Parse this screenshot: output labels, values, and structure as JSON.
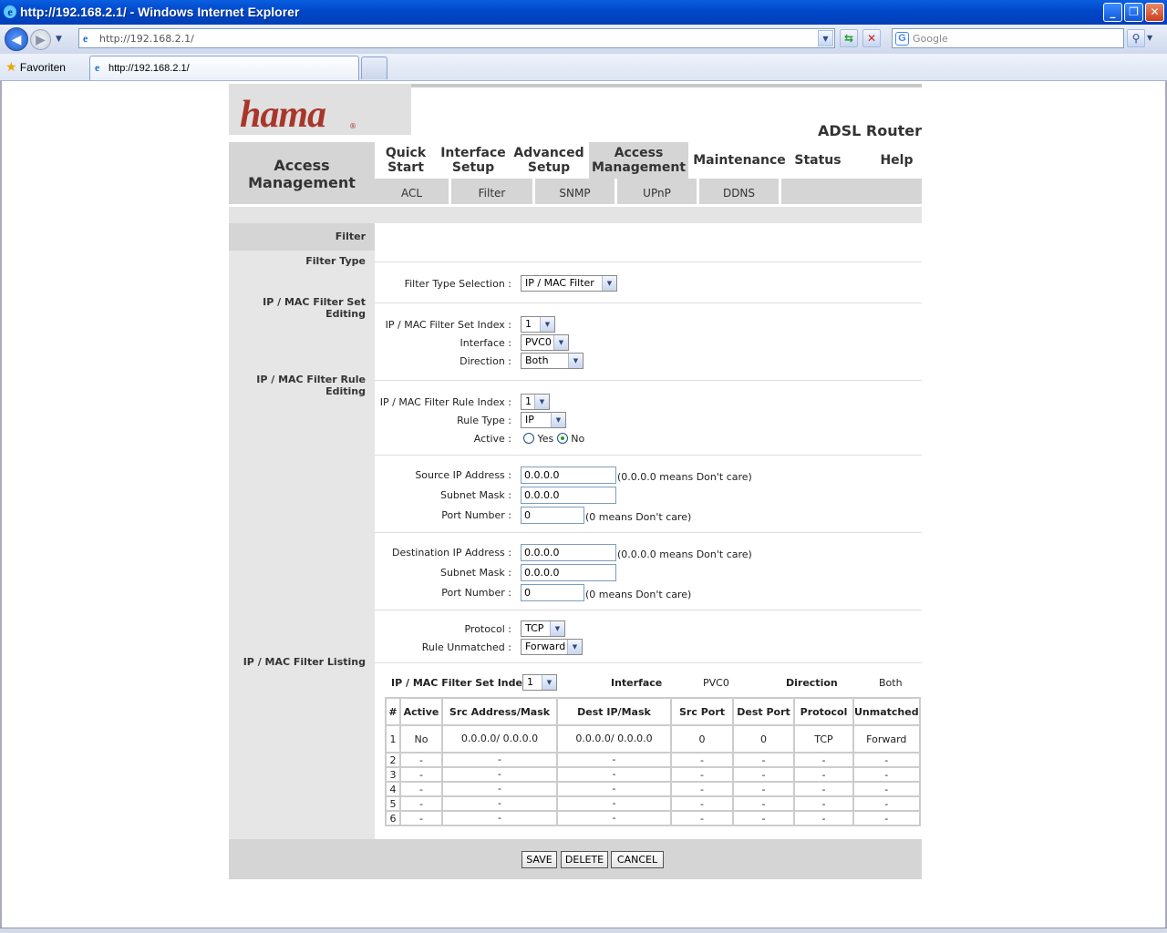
{
  "window": {
    "title": "http://192.168.2.1/ - Windows Internet Explorer"
  },
  "browser": {
    "address": "http://192.168.2.1/",
    "search_placeholder": "Google",
    "favorites_label": "Favoriten",
    "tab_title": "http://192.168.2.1/"
  },
  "router": {
    "brand": "hama",
    "model": "ADSL Router",
    "section_title": "Access Management",
    "nav": [
      {
        "label": "Quick Start"
      },
      {
        "label": "Interface Setup"
      },
      {
        "label": "Advanced Setup"
      },
      {
        "label": "Access Management"
      },
      {
        "label": "Maintenance"
      },
      {
        "label": "Status"
      },
      {
        "label": "Help"
      }
    ],
    "subnav": [
      "ACL",
      "Filter",
      "SNMP",
      "UPnP",
      "DDNS"
    ],
    "left": {
      "filter": "Filter",
      "filter_type": "Filter Type",
      "set_editing": "IP / MAC Filter Set Editing",
      "rule_editing": "IP / MAC Filter Rule Editing",
      "listing": "IP / MAC Filter Listing"
    },
    "form": {
      "filter_type_selection_label": "Filter Type Selection :",
      "filter_type_selection_value": "IP / MAC Filter",
      "set_index_label": "IP / MAC Filter Set Index :",
      "set_index_value": "1",
      "interface_label": "Interface :",
      "interface_value": "PVC0",
      "direction_label": "Direction :",
      "direction_value": "Both",
      "rule_index_label": "IP / MAC Filter Rule Index :",
      "rule_index_value": "1",
      "rule_type_label": "Rule Type :",
      "rule_type_value": "IP",
      "active_label": "Active :",
      "active_yes": "Yes",
      "active_no": "No",
      "src_ip_label": "Source IP Address :",
      "src_ip_value": "0.0.0.0",
      "src_ip_note": "(0.0.0.0 means Don't care)",
      "src_mask_label": "Subnet Mask :",
      "src_mask_value": "0.0.0.0",
      "src_port_label": "Port Number :",
      "src_port_value": "0",
      "src_port_note": "(0 means Don't care)",
      "dst_ip_label": "Destination IP Address :",
      "dst_ip_value": "0.0.0.0",
      "dst_ip_note": "(0.0.0.0 means Don't care)",
      "dst_mask_label": "Subnet Mask :",
      "dst_mask_value": "0.0.0.0",
      "dst_port_label": "Port Number :",
      "dst_port_value": "0",
      "dst_port_note": "(0 means Don't care)",
      "protocol_label": "Protocol :",
      "protocol_value": "TCP",
      "unmatched_label": "Rule Unmatched :",
      "unmatched_value": "Forward"
    },
    "listing": {
      "set_index_label": "IP / MAC Filter Set Index",
      "set_index_value": "1",
      "interface_label": "Interface",
      "interface_value": "PVC0",
      "direction_label": "Direction",
      "direction_value": "Both",
      "headers": [
        "#",
        "Active",
        "Src Address/Mask",
        "Dest IP/Mask",
        "Src Port",
        "Dest Port",
        "Protocol",
        "Unmatched"
      ],
      "rows": [
        [
          "1",
          "No",
          "0.0.0.0/ 0.0.0.0",
          "0.0.0.0/ 0.0.0.0",
          "0",
          "0",
          "TCP",
          "Forward"
        ],
        [
          "2",
          "-",
          "-",
          "-",
          "-",
          "-",
          "-",
          "-"
        ],
        [
          "3",
          "-",
          "-",
          "-",
          "-",
          "-",
          "-",
          "-"
        ],
        [
          "4",
          "-",
          "-",
          "-",
          "-",
          "-",
          "-",
          "-"
        ],
        [
          "5",
          "-",
          "-",
          "-",
          "-",
          "-",
          "-",
          "-"
        ],
        [
          "6",
          "-",
          "-",
          "-",
          "-",
          "-",
          "-",
          "-"
        ]
      ]
    },
    "buttons": {
      "save": "SAVE",
      "delete": "DELETE",
      "cancel": "CANCEL"
    }
  }
}
